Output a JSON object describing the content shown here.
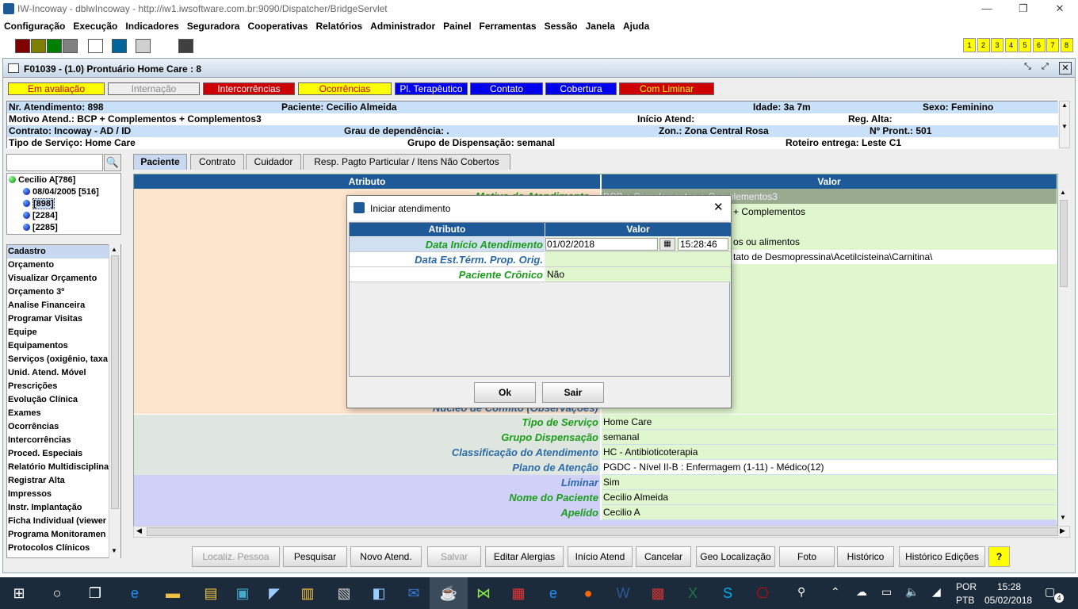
{
  "window": {
    "title": "IW-Incoway - dblwIncoway - http://iw1.iwsoftware.com.br:9090/Dispatcher/BridgeServlet"
  },
  "menubar": [
    "Configuração",
    "Execução",
    "Indicadores",
    "Seguradora",
    "Cooperativas",
    "Relatórios",
    "Administrador",
    "Painel",
    "Ferramentas",
    "Sessão",
    "Janela",
    "Ajuda"
  ],
  "toolbar": {
    "numbers": [
      "1",
      "2",
      "3",
      "4",
      "5",
      "6",
      "7",
      "8"
    ]
  },
  "colors": {
    "header_blue": "#1e5a98",
    "value_green": "#dff6cf",
    "attr_peach": "#fde4cc",
    "attr_gray": "#dfe6df",
    "attr_lilac": "#d0d0f8"
  },
  "frame": {
    "title": "F01039 - (1.0) Prontuário Home Care : 8"
  },
  "status_buttons": [
    {
      "label": "Em avaliação",
      "bg": "#ffff00",
      "fg": "#cc0000"
    },
    {
      "label": "Internação",
      "bg": "#eeeeee",
      "fg": "#888888"
    },
    {
      "label": "Intercorrências",
      "bg": "#cc0000",
      "fg": "#ffffff"
    },
    {
      "label": "Ocorrências",
      "bg": "#ffff00",
      "fg": "#cc0000"
    },
    {
      "label": "Pl. Terapêutico",
      "bg": "#0000ee",
      "fg": "#ffffff"
    },
    {
      "label": "Contato",
      "bg": "#0000ee",
      "fg": "#ffffff"
    },
    {
      "label": "Cobertura",
      "bg": "#0000ee",
      "fg": "#ffffff"
    },
    {
      "label": "Com Liminar",
      "bg": "#cc0000",
      "fg": "#ffff00"
    }
  ],
  "info": {
    "nr": "Nr. Atendimento: 898",
    "paciente": "Paciente: Cecilio Almeida",
    "idade": "Idade: 3a 7m",
    "sexo": "Sexo: Feminino",
    "motivo": "Motivo Atend.: BCP + Complementos + Complementos3",
    "inicio": "Início Atend:",
    "alta": "Reg. Alta:",
    "contrato": "Contrato: Incoway - AD / ID",
    "grau": "Grau de dependência: .",
    "zona": "Zon.: Zona Central Rosa",
    "pront": "Nº Pront.: 501",
    "servico": "Tipo de Serviço: Home Care",
    "grupo": "Grupo de Dispensação: semanal",
    "roteiro": "Roteiro entrega: Leste C1"
  },
  "tree": {
    "root": "Cecilio A[786]",
    "children": [
      "08/04/2005 [516]",
      "[898]",
      "[2284]",
      "[2285]"
    ]
  },
  "side_menu": [
    "Cadastro",
    "Orçamento",
    "Visualizar Orçamento",
    "Orçamento 3º",
    "Analise Financeira",
    "Programar Visitas",
    "Equipe",
    "Equipamentos",
    "Serviços (oxigênio, taxa",
    "Unid. Atend. Móvel",
    "Prescrições",
    "Evolução Clínica",
    "Exames",
    "Ocorrências",
    "Intercorrências",
    "Proced. Especiais",
    "Relatório Multidisciplina",
    "Registrar Alta",
    "Impressos",
    "Instr. Implantação",
    "Ficha Individual (viewer",
    "Programa Monitoramen",
    "Protocolos Clínicos"
  ],
  "tabs": [
    "Paciente",
    "Contrato",
    "Cuidador",
    "Resp. Pagto Particular / Itens Não Cobertos"
  ],
  "grid": {
    "header": {
      "attr": "Atributo",
      "val": "Valor"
    },
    "top_fragments": [
      "Motivo do Atendimento",
      "BCP + Complementos + Complementos3",
      "+ Complementos",
      "os ou alimentos",
      "tato de Desmopressina\\Acetilcisteina\\Carnitina\\",
      "Núcleo de Conflito (Observações)"
    ],
    "rows": [
      {
        "attr": "Tipo de Serviço",
        "val": "Home Care",
        "color": "#1a9e1a"
      },
      {
        "attr": "Grupo Dispensação",
        "val": "semanal",
        "color": "#1a9e1a"
      },
      {
        "attr": "Classificação do Atendimento",
        "val": "HC - Antibioticoterapia",
        "color": "#2a6aa8"
      },
      {
        "attr": "Plano de Atenção",
        "val": "PGDC - Nível II-B : Enfermagem (1-11) - Médico(12)",
        "color": "#2a6aa8"
      },
      {
        "attr": "Liminar",
        "val": "Sim",
        "color": "#2a6aa8"
      },
      {
        "attr": "Nome do Paciente",
        "val": "Cecilio Almeida",
        "color": "#1a9e1a"
      },
      {
        "attr": "Apelido",
        "val": "Cecilio A",
        "color": "#1a9e1a"
      }
    ]
  },
  "bottom_buttons": [
    "Localiz. Pessoa",
    "Pesquisar",
    "Novo Atend.",
    "Salvar",
    "Editar Alergias",
    "Início Atend",
    "Cancelar",
    "Geo Localização",
    "Foto",
    "Histórico",
    "Histórico Edições",
    "?"
  ],
  "dialog": {
    "title": "Iniciar atendimento",
    "header": {
      "attr": "Atributo",
      "val": "Valor"
    },
    "rows": [
      {
        "attr": "Data Início Atendimento",
        "date": "01/02/2018",
        "time": "15:28:46"
      },
      {
        "attr": "Data Est.Térm. Prop. Orig.",
        "val": ""
      },
      {
        "attr": "Paciente Crônico",
        "val": "Não"
      }
    ],
    "ok": "Ok",
    "exit": "Sair"
  },
  "taskbar": {
    "lang": "POR",
    "lang2": "PTB",
    "time": "15:28",
    "date": "05/02/2018",
    "notif": "4"
  }
}
